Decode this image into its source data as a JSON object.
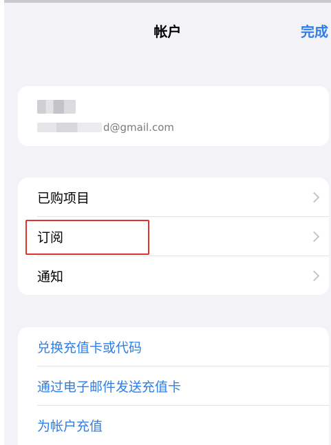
{
  "header": {
    "title": "帐户",
    "done_label": "完成"
  },
  "account": {
    "email_visible_part": "d@gmail.com"
  },
  "menu": {
    "items": [
      {
        "label": "已购项目"
      },
      {
        "label": "订阅"
      },
      {
        "label": "通知"
      }
    ]
  },
  "actions": {
    "items": [
      {
        "label": "兑换充值卡或代码"
      },
      {
        "label": "通过电子邮件发送充值卡"
      },
      {
        "label": "为帐户充值"
      }
    ]
  },
  "colors": {
    "accent": "#2f7ee6",
    "highlight": "#e0322c",
    "background": "#f2f2f7",
    "card": "#ffffff"
  }
}
